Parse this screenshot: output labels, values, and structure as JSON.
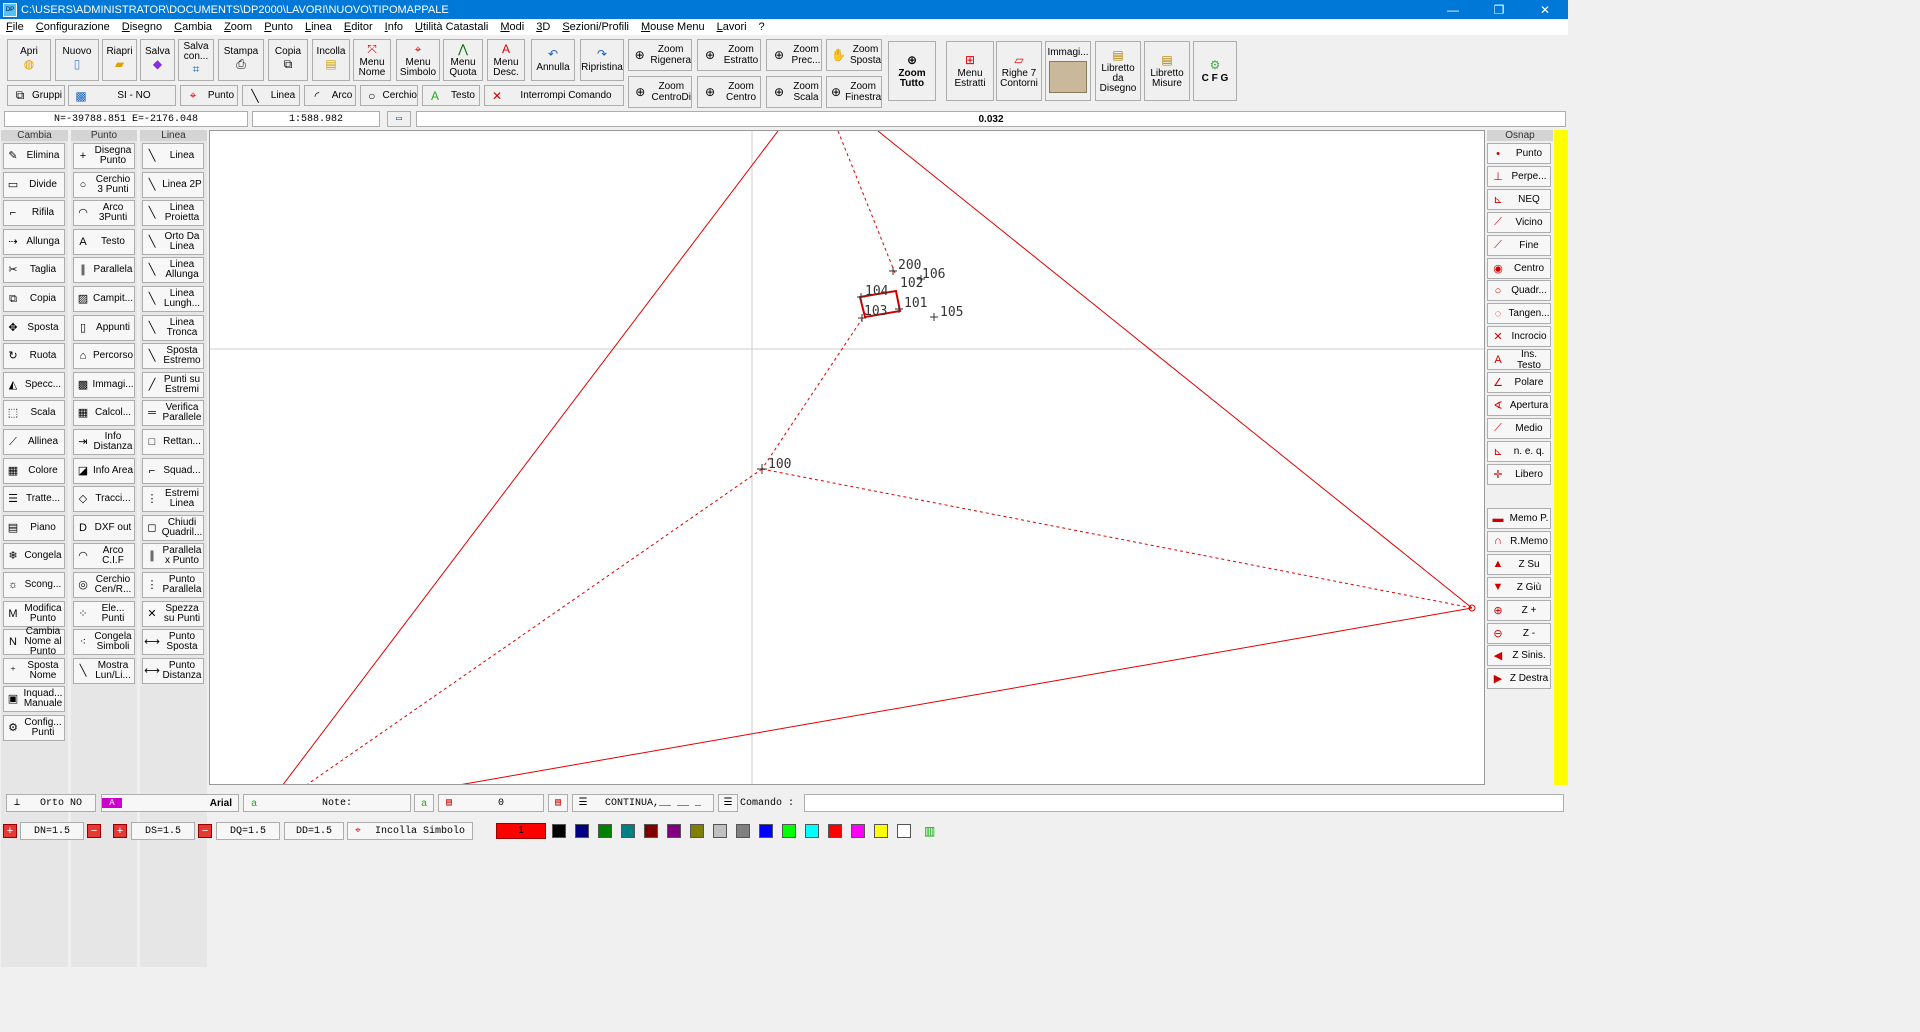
{
  "window": {
    "title": "C:\\USERS\\ADMINISTRATOR\\DOCUMENTS\\DP2000\\LAVORI\\NUOVO\\TIPOMAPPALE",
    "minimize": "—",
    "maximize": "❐",
    "close": "✕"
  },
  "menu": [
    "File",
    "Configurazione",
    "Disegno",
    "Cambia",
    "Zoom",
    "Punto",
    "Linea",
    "Editor",
    "Info",
    "Utilità Catastali",
    "Modi",
    "3D",
    "Sezioni/Profili",
    "Mouse Menu",
    "Lavori",
    "?"
  ],
  "toolbar": {
    "apri": "Apri",
    "nuovo": "Nuovo",
    "riapri": "Riapri",
    "salva": "Salva",
    "salva_con": "Salva con...",
    "stampa": "Stampa",
    "copia": "Copia",
    "incolla": "Incolla",
    "menu_nome": "Menu Nome",
    "menu_simbolo": "Menu Simbolo",
    "menu_quota": "Menu Quota",
    "menu_desc": "Menu Desc.",
    "annulla": "Annulla",
    "ripristina": "Ripristina",
    "zoom_rigenera": "Zoom Rigenera",
    "zoom_estratto": "Zoom Estratto",
    "zoom_prec": "Zoom Prec...",
    "zoom_sposta": "Zoom Sposta",
    "zoom_centrodi": "Zoom CentroDi",
    "zoom_centro": "Zoom Centro",
    "zoom_scala": "Zoom Scala",
    "zoom_finestra": "Zoom Finestra",
    "zoom_tutto": "Zoom Tutto",
    "menu_estratti": "Menu Estratti",
    "righe_contorni": "Righe 7 Contorni",
    "immagini": "Immagi...",
    "libretto_disegno": "Libretto da Disegno",
    "libretto_misure": "Libretto Misure",
    "cfg": "C F G",
    "gruppi": "Gruppi",
    "si_no": "SI - NO",
    "punto": "Punto",
    "linea": "Linea",
    "arco": "Arco",
    "cerchio": "Cerchio",
    "testo": "Testo",
    "interrompi": "Interrompi Comando"
  },
  "status": {
    "coords": "N=-39788.851 E=-2176.048",
    "scale": "1:588.982",
    "value": "0.032"
  },
  "columns": {
    "cambia": "Cambia",
    "punto": "Punto",
    "linea": "Linea",
    "osnap": "Osnap"
  },
  "cambia_items": [
    {
      "label": "Elimina",
      "icon": "✎"
    },
    {
      "label": "Divide",
      "icon": "▭"
    },
    {
      "label": "Rifila",
      "icon": "⌐"
    },
    {
      "label": "Allunga",
      "icon": "⇢"
    },
    {
      "label": "Taglia",
      "icon": "✂"
    },
    {
      "label": "Copia",
      "icon": "⧉"
    },
    {
      "label": "Sposta",
      "icon": "✥"
    },
    {
      "label": "Ruota",
      "icon": "↻"
    },
    {
      "label": "Specc...",
      "icon": "◭"
    },
    {
      "label": "Scala",
      "icon": "⬚"
    },
    {
      "label": "Allinea",
      "icon": "⟋"
    },
    {
      "label": "Colore",
      "icon": "▦"
    },
    {
      "label": "Tratte...",
      "icon": "☰"
    },
    {
      "label": "Piano",
      "icon": "▤"
    },
    {
      "label": "Congela",
      "icon": "❄"
    },
    {
      "label": "Scong...",
      "icon": "☼"
    },
    {
      "label": "Modifica Punto",
      "icon": "M"
    },
    {
      "label": "Cambia Nome al Punto",
      "icon": "N"
    },
    {
      "label": "Sposta Nome",
      "icon": "⁺"
    },
    {
      "label": "Inquad... Manuale",
      "icon": "▣"
    },
    {
      "label": "Config... Punti",
      "icon": "⚙"
    }
  ],
  "punto_items": [
    {
      "label": "Disegna Punto",
      "icon": "+"
    },
    {
      "label": "Cerchio 3 Punti",
      "icon": "○"
    },
    {
      "label": "Arco 3Punti",
      "icon": "◠"
    },
    {
      "label": "Testo",
      "icon": "A"
    },
    {
      "label": "Parallela",
      "icon": "∥"
    },
    {
      "label": "Campit...",
      "icon": "▨"
    },
    {
      "label": "Appunti",
      "icon": "▯"
    },
    {
      "label": "Percorso",
      "icon": "⌂"
    },
    {
      "label": "Immagi...",
      "icon": "▩"
    },
    {
      "label": "Calcol...",
      "icon": "▦"
    },
    {
      "label": "Info Distanza",
      "icon": "⇥"
    },
    {
      "label": "Info Area",
      "icon": "◪"
    },
    {
      "label": "Tracci...",
      "icon": "◇"
    },
    {
      "label": "DXF out",
      "icon": "D"
    },
    {
      "label": "Arco C.I.F",
      "icon": "◠"
    },
    {
      "label": "Cerchio Cen/R...",
      "icon": "◎"
    },
    {
      "label": "Ele... Punti",
      "icon": "⁘"
    },
    {
      "label": "Congela Simboli",
      "icon": "⁖"
    },
    {
      "label": "Mostra Lun/Li...",
      "icon": "╲"
    }
  ],
  "linea_items": [
    {
      "label": "Linea",
      "icon": "╲"
    },
    {
      "label": "Linea 2P",
      "icon": "╲"
    },
    {
      "label": "Linea Proietta",
      "icon": "╲"
    },
    {
      "label": "Orto Da Linea",
      "icon": "╲"
    },
    {
      "label": "Linea Allunga",
      "icon": "╲"
    },
    {
      "label": "Linea Lungh...",
      "icon": "╲"
    },
    {
      "label": "Linea Tronca",
      "icon": "╲"
    },
    {
      "label": "Sposta Estremo",
      "icon": "╲"
    },
    {
      "label": "Punti su Estremi",
      "icon": "╱"
    },
    {
      "label": "Verifica Parallele",
      "icon": "═"
    },
    {
      "label": "Rettan...",
      "icon": "□"
    },
    {
      "label": "Squad...",
      "icon": "⌐"
    },
    {
      "label": "Estremi Linea",
      "icon": "⋮"
    },
    {
      "label": "Chiudi Quadril...",
      "icon": "◻"
    },
    {
      "label": "Parallela x Punto",
      "icon": "∥"
    },
    {
      "label": "Punto Parallela",
      "icon": "⋮"
    },
    {
      "label": "Spezza su Punti",
      "icon": "✕"
    },
    {
      "label": "Punto Sposta",
      "icon": "⟷"
    },
    {
      "label": "Punto Distanza",
      "icon": "⟷"
    }
  ],
  "osnap_items": [
    {
      "label": "Punto",
      "icon": "•"
    },
    {
      "label": "Perpe...",
      "icon": "⊥"
    },
    {
      "label": "NEQ",
      "icon": "⊾"
    },
    {
      "label": "Vicino",
      "icon": "⟋"
    },
    {
      "label": "Fine",
      "icon": "⟋"
    },
    {
      "label": "Centro",
      "icon": "◉"
    },
    {
      "label": "Quadr...",
      "icon": "○"
    },
    {
      "label": "Tangen...",
      "icon": "◌"
    },
    {
      "label": "Incrocio",
      "icon": "✕"
    },
    {
      "label": "Ins. Testo",
      "icon": "A"
    },
    {
      "label": "Polare",
      "icon": "∠"
    },
    {
      "label": "Apertura",
      "icon": "∢"
    },
    {
      "label": "Medio",
      "icon": "⟋"
    },
    {
      "label": "n. e. q.",
      "icon": "⊾"
    },
    {
      "label": "Libero",
      "icon": "✛"
    }
  ],
  "osnap_items2": [
    {
      "label": "Memo P.",
      "icon": "▬"
    },
    {
      "label": "R.Memo",
      "icon": "∩"
    },
    {
      "label": "Z Su",
      "icon": "▲"
    },
    {
      "label": "Z Giù",
      "icon": "▼"
    },
    {
      "label": "Z +",
      "icon": "⊕"
    },
    {
      "label": "Z -",
      "icon": "⊖"
    },
    {
      "label": "Z Sinis.",
      "icon": "◀"
    },
    {
      "label": "Z Destra",
      "icon": "▶"
    }
  ],
  "drawing": {
    "points": [
      "200",
      "106",
      "104",
      "102",
      "101",
      "103",
      "105",
      "100"
    ]
  },
  "bottom": {
    "orto": "Orto NO",
    "font": "Arial",
    "note": "Note:",
    "layer": "0",
    "linetype": "CONTINUA,__ __ _",
    "comando": "Comando :",
    "dn": "DN=1.5",
    "ds": "DS=1.5",
    "dq": "DQ=1.5",
    "dd": "DD=1.5",
    "incolla_simbolo": "Incolla Simbolo",
    "current_color": "1",
    "palette": [
      "#000000",
      "#000080",
      "#008000",
      "#008080",
      "#800000",
      "#800080",
      "#808000",
      "#c0c0c0",
      "#808080",
      "#0000ff",
      "#00ff00",
      "#00ffff",
      "#ff0000",
      "#ff00ff",
      "#ffff00",
      "#ffffff"
    ]
  }
}
